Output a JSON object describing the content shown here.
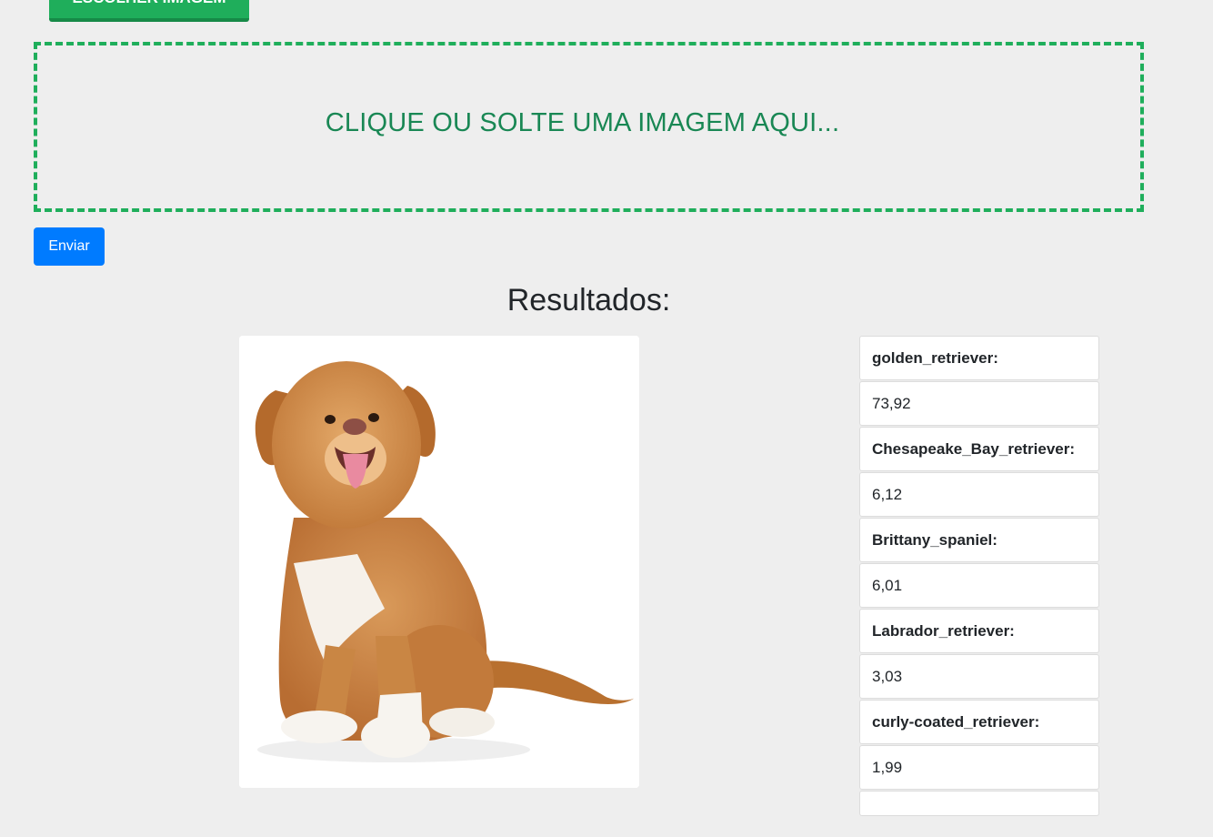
{
  "upload": {
    "choose_label": "ESCOLHER IMAGEM",
    "drop_text": "CLIQUE OU SOLTE UMA IMAGEM AQUI...",
    "send_label": "Enviar"
  },
  "results": {
    "title": "Resultados:",
    "image_description": "puppy",
    "predictions": [
      {
        "label": "golden_retriever:",
        "value": "73,92"
      },
      {
        "label": "Chesapeake_Bay_retriever:",
        "value": "6,12"
      },
      {
        "label": "Brittany_spaniel:",
        "value": "6,01"
      },
      {
        "label": "Labrador_retriever:",
        "value": "3,03"
      },
      {
        "label": "curly-coated_retriever:",
        "value": "1,99"
      }
    ]
  },
  "colors": {
    "background": "#eeeeee",
    "accent_green": "#1fae5b",
    "drop_text_green": "#198754",
    "primary_blue": "#007bff"
  }
}
